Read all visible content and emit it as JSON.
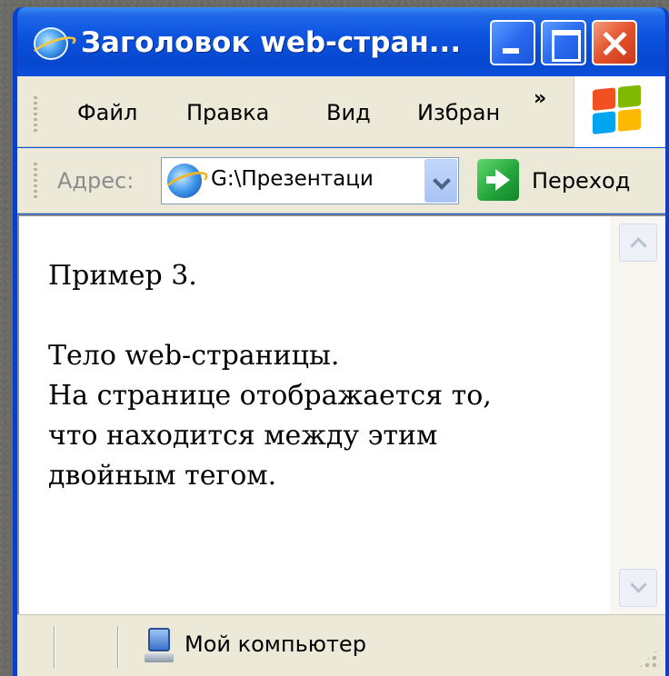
{
  "window": {
    "title": "Заголовок web-стран...",
    "controls": {
      "minimize": "minimize",
      "maximize": "maximize",
      "close": "close"
    }
  },
  "menubar": {
    "items": [
      "Файл",
      "Правка",
      "Вид",
      "Избран"
    ],
    "more": "»"
  },
  "addressbar": {
    "label": "Адрес:",
    "value": "G:\\Презентаци",
    "go_label": "Переход"
  },
  "content": {
    "line1": "Пример 3.",
    "line2": "Тело web-страницы.",
    "line3": "На странице отображается то,",
    "line4": "что находится между этим",
    "line5": "двойным тегом."
  },
  "statusbar": {
    "zone": "Мой компьютер"
  },
  "colors": {
    "titlebar": "#0a52de",
    "chrome": "#ece9d8",
    "close": "#e4522d",
    "go": "#21a33a"
  },
  "icons": [
    "ie-page-icon",
    "minimize-icon",
    "maximize-icon",
    "close-icon",
    "windows-logo-icon",
    "ie-address-icon",
    "dropdown-arrow-icon",
    "go-arrow-icon",
    "my-computer-icon",
    "resize-grip-icon"
  ]
}
